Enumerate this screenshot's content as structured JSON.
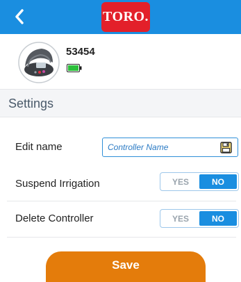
{
  "header": {
    "back_icon": "chevron-left-icon",
    "logo_text": "TORO.",
    "bar_color": "#1a8ee0",
    "logo_color": "#e3202a"
  },
  "device": {
    "id": "53454",
    "battery_icon": "battery-full-icon",
    "battery_color": "#2bbf3a"
  },
  "settings": {
    "title": "Settings",
    "edit_name": {
      "label": "Edit name",
      "value": "",
      "placeholder": "Controller Name",
      "save_icon": "floppy-disk-icon"
    },
    "suspend_irrigation": {
      "label": "Suspend Irrigation",
      "yes": "YES",
      "no": "NO",
      "selected": "NO"
    },
    "delete_controller": {
      "label": "Delete Controller",
      "yes": "YES",
      "no": "NO",
      "selected": "NO"
    }
  },
  "footer": {
    "save_label": "Save",
    "save_color": "#e47c0b"
  }
}
